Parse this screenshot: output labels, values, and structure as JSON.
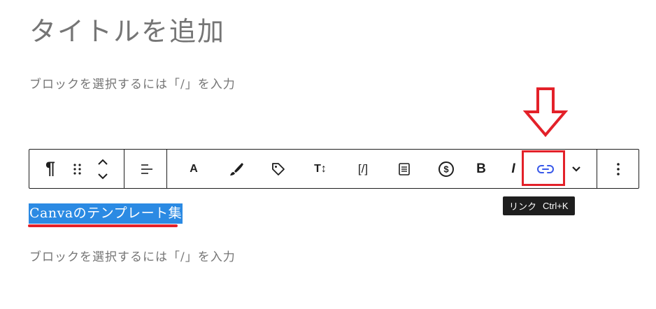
{
  "editor": {
    "title_placeholder": "タイトルを追加",
    "block_placeholder": "ブロックを選択するには「/」を入力",
    "selected_paragraph": "Canvaのテンプレート集"
  },
  "toolbar": {
    "paragraph_symbol": "¶",
    "bold_label": "B",
    "italic_label": "I",
    "text_color_label": "A",
    "font_size_label": "T↕",
    "shortcode_label": "[/]"
  },
  "tooltip": {
    "label": "リンク",
    "shortcut": "Ctrl+K"
  },
  "icons": [
    "paragraph-icon",
    "drag-handle-icon",
    "move-up-icon",
    "move-down-icon",
    "align-icon",
    "text-color-icon",
    "brush-icon",
    "tag-icon",
    "font-size-icon",
    "shortcode-icon",
    "document-icon",
    "dollar-icon",
    "bold-icon",
    "italic-icon",
    "link-icon",
    "chevron-down-icon",
    "more-options-icon"
  ],
  "colors": {
    "annotation_red": "#e32129",
    "selection_blue": "#2b8ae3",
    "link_blue": "#3858e9",
    "toolbar_border": "#1e1e1e",
    "placeholder_gray": "#757575"
  }
}
